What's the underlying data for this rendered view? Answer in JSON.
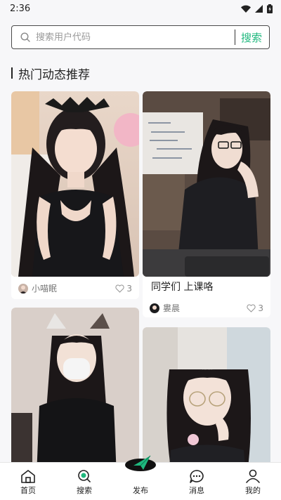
{
  "status_bar": {
    "time": "2:36"
  },
  "search": {
    "placeholder": "搜索用户代码",
    "button_label": "搜索"
  },
  "section": {
    "title": "热门动态推荐"
  },
  "feed": {
    "cards": [
      {
        "author": "小喵眠",
        "likes": "3",
        "title": ""
      },
      {
        "author": "婁晨",
        "likes": "3",
        "title": "同学们 上课咯"
      },
      {
        "author": "",
        "likes": "",
        "title": ""
      },
      {
        "author": "",
        "likes": "",
        "title": ""
      }
    ]
  },
  "tabbar": {
    "items": [
      {
        "label": "首页",
        "icon": "home-icon"
      },
      {
        "label": "搜索",
        "icon": "search-icon"
      },
      {
        "label": "发布",
        "icon": "publish-icon"
      },
      {
        "label": "消息",
        "icon": "message-icon"
      },
      {
        "label": "我的",
        "icon": "user-icon"
      }
    ]
  },
  "colors": {
    "accent": "#1fb87e",
    "background": "#f7f7f9",
    "card": "#ffffff",
    "text": "#222222"
  }
}
